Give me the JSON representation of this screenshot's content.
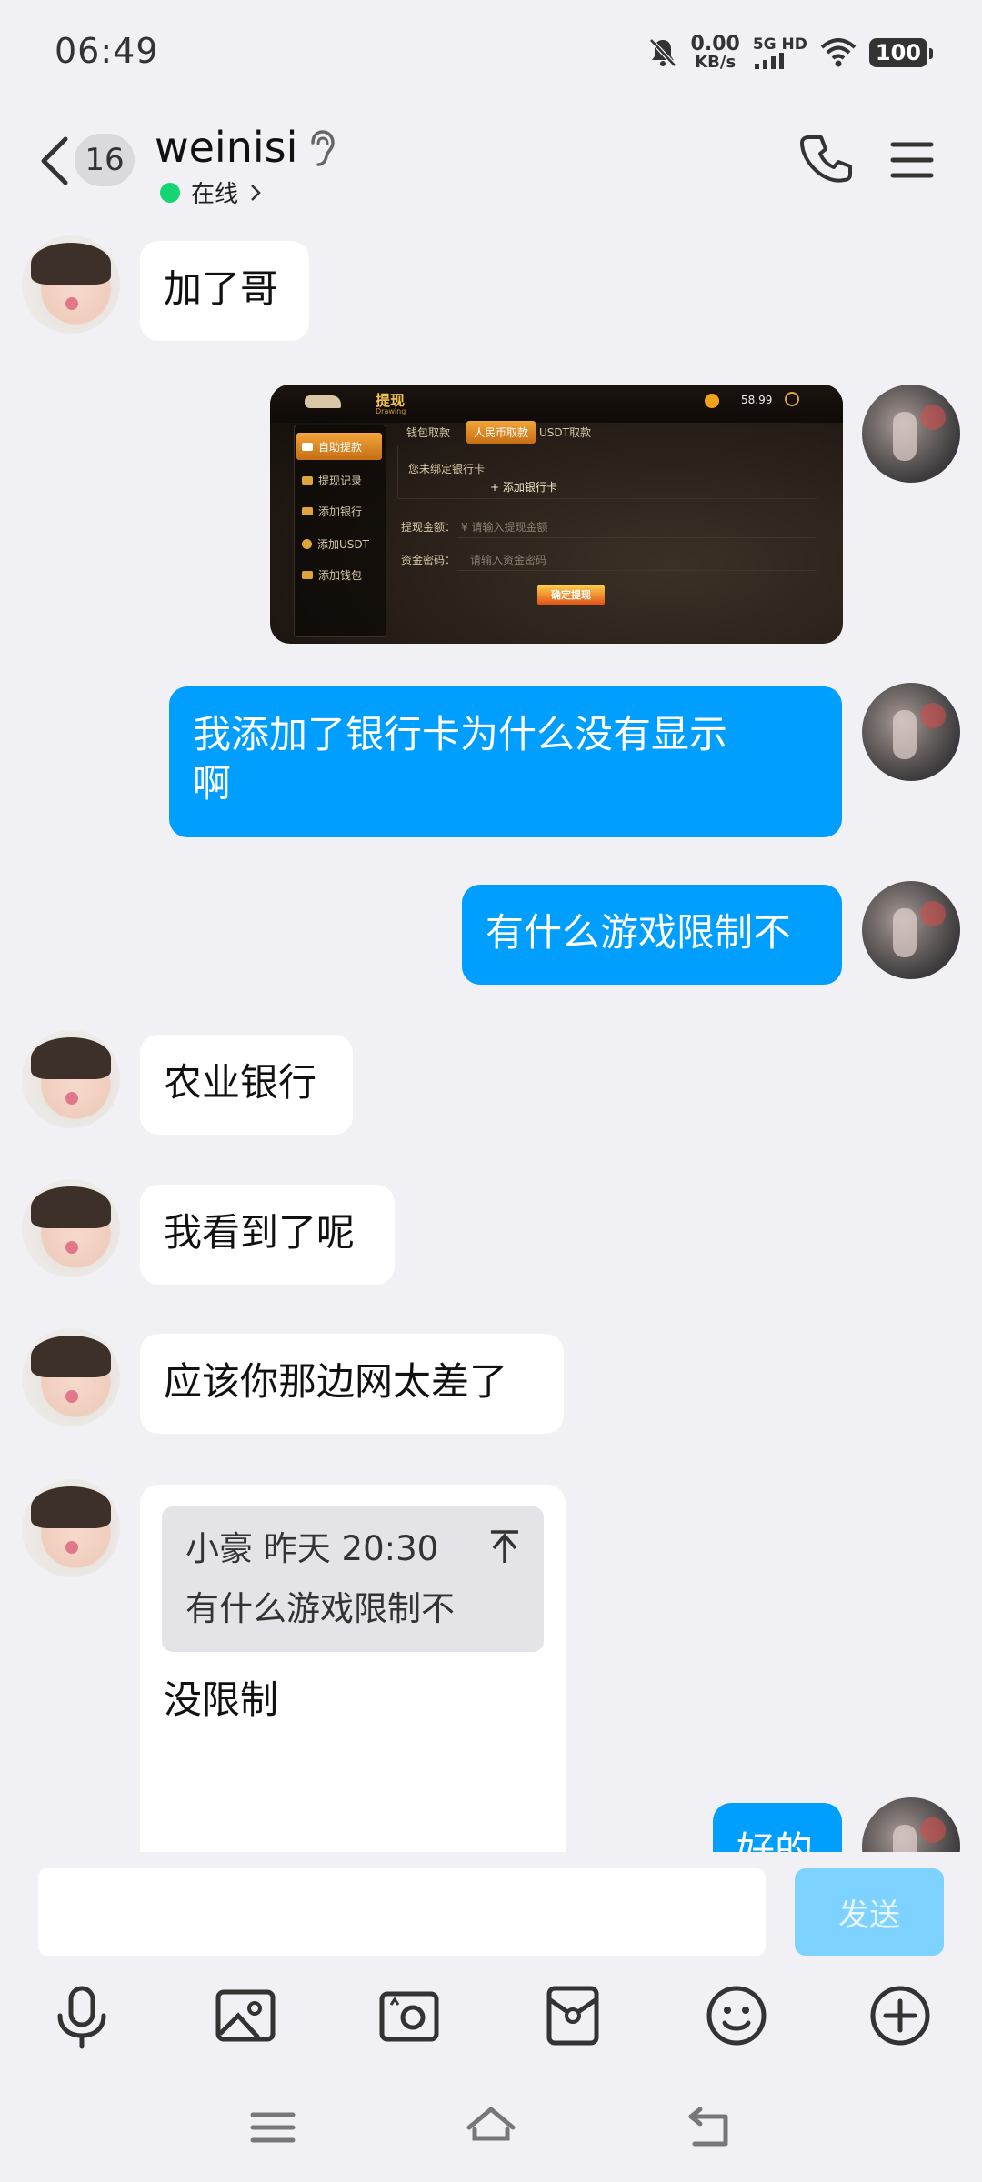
{
  "status_bar": {
    "time": "06:49",
    "net_speed_value": "0.00",
    "net_speed_unit": "KB/s",
    "net_type": "5G",
    "net_hd": "HD",
    "battery": "100"
  },
  "header": {
    "unread_count": "16",
    "contact_name": "weinisi",
    "status": "在线",
    "colors": {
      "online": "#13d670"
    }
  },
  "messages": [
    {
      "direction": "in",
      "text": "加了哥"
    },
    {
      "direction": "out",
      "type": "image"
    },
    {
      "direction": "out",
      "text_line1": "我添加了银行卡为什么没有显示",
      "text_line2": "啊"
    },
    {
      "direction": "out",
      "text": "有什么游戏限制不"
    },
    {
      "direction": "in",
      "text": "农业银行"
    },
    {
      "direction": "in",
      "text": "我看到了呢"
    },
    {
      "direction": "in",
      "text": "应该你那边网太差了"
    },
    {
      "direction": "in",
      "quote_sender": "小豪",
      "quote_time": "昨天 20:30",
      "quote_text": "有什么游戏限制不",
      "text": "没限制"
    },
    {
      "direction": "out",
      "text": "好的"
    }
  ],
  "screenshot": {
    "title": "提现",
    "subtitle": "Drawing",
    "balance": "58.99",
    "sidebar": [
      "自助提款",
      "提现记录",
      "添加银行",
      "添加USDT",
      "添加钱包"
    ],
    "tabs": [
      "钱包取款",
      "人民币取款",
      "USDT取款"
    ],
    "no_card": "您未绑定银行卡",
    "add_card": "+ 添加银行卡",
    "amount_label": "提现金额：",
    "amount_placeholder": "¥ 请输入提现金额",
    "password_label": "资金密码：",
    "password_placeholder": "请输入资金密码",
    "confirm": "确定提现"
  },
  "composer": {
    "placeholder": "",
    "send_label": "发送",
    "tools": [
      "microphone-icon",
      "image-icon",
      "camera-icon",
      "red-packet-icon",
      "emoji-icon",
      "plus-icon"
    ]
  },
  "colors": {
    "outgoing_bubble": "#009eff",
    "incoming_bubble": "#ffffff",
    "background": "#f0f0f5",
    "send_button": "#7dd2ff"
  }
}
